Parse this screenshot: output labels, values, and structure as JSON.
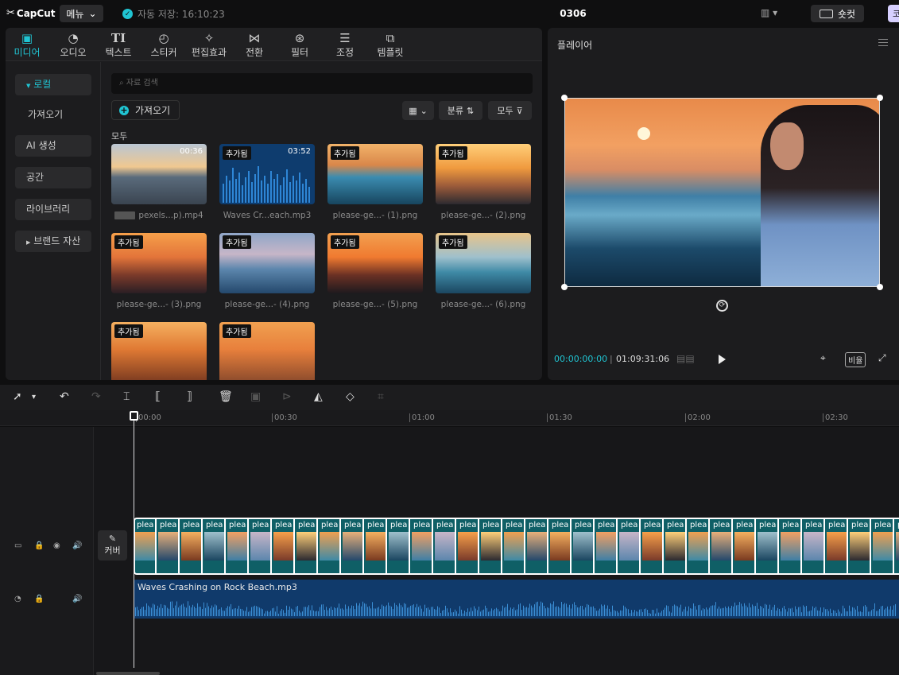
{
  "top": {
    "logo": "CapCut",
    "menu": "메뉴",
    "autosave": "자동 저장: 16:10:23",
    "project": "0306",
    "shortcut": "숏컷",
    "export_stub": "코"
  },
  "media_tabs": [
    {
      "label": "미디어",
      "icon": "media-icon"
    },
    {
      "label": "오디오",
      "icon": "audio-icon"
    },
    {
      "label": "텍스트",
      "icon": "text-icon"
    },
    {
      "label": "스티커",
      "icon": "sticker-icon"
    },
    {
      "label": "편집효과",
      "icon": "effects-icon"
    },
    {
      "label": "전환",
      "icon": "transition-icon"
    },
    {
      "label": "필터",
      "icon": "filter-icon"
    },
    {
      "label": "조정",
      "icon": "adjust-icon"
    },
    {
      "label": "템플릿",
      "icon": "template-icon"
    }
  ],
  "sidebar": [
    {
      "label": "로컬"
    },
    {
      "label": "가져오기"
    },
    {
      "label": "AI 생성"
    },
    {
      "label": "공간"
    },
    {
      "label": "라이브러리"
    },
    {
      "label": "브랜드 자산"
    }
  ],
  "media": {
    "search_placeholder": "자료 검색",
    "import": "가져오기",
    "sort": "분류",
    "filter": "모두",
    "all_label": "모두",
    "items": [
      {
        "caption": "pexels...p).mp4",
        "badge": "",
        "duration": "00:36"
      },
      {
        "caption": "Waves Cr...each.mp3",
        "badge": "추가됨",
        "duration": "03:52"
      },
      {
        "caption": "please-ge...- (1).png",
        "badge": "추가됨",
        "duration": ""
      },
      {
        "caption": "please-ge...- (2).png",
        "badge": "추가됨",
        "duration": ""
      },
      {
        "caption": "please-ge...- (3).png",
        "badge": "추가됨",
        "duration": ""
      },
      {
        "caption": "please-ge...- (4).png",
        "badge": "추가됨",
        "duration": ""
      },
      {
        "caption": "please-ge...- (5).png",
        "badge": "추가됨",
        "duration": ""
      },
      {
        "caption": "please-ge...- (6).png",
        "badge": "추가됨",
        "duration": ""
      },
      {
        "caption": "",
        "badge": "추가됨",
        "duration": ""
      },
      {
        "caption": "",
        "badge": "추가됨",
        "duration": ""
      }
    ]
  },
  "player": {
    "title": "플레이어",
    "current": "00:00:00:00",
    "total": "01:09:31:06",
    "ratio": "비율"
  },
  "timeline": {
    "ticks": [
      "00:00",
      "00:30",
      "01:00",
      "01:30",
      "02:00",
      "02:30"
    ],
    "cover": "커버",
    "clip_label": "plea",
    "audio_label": "Waves Crashing on Rock Beach.mp3"
  },
  "colors": {
    "accent": "#20c5d3",
    "audio_track": "#103a6b",
    "video_track": "#0f5f66"
  }
}
